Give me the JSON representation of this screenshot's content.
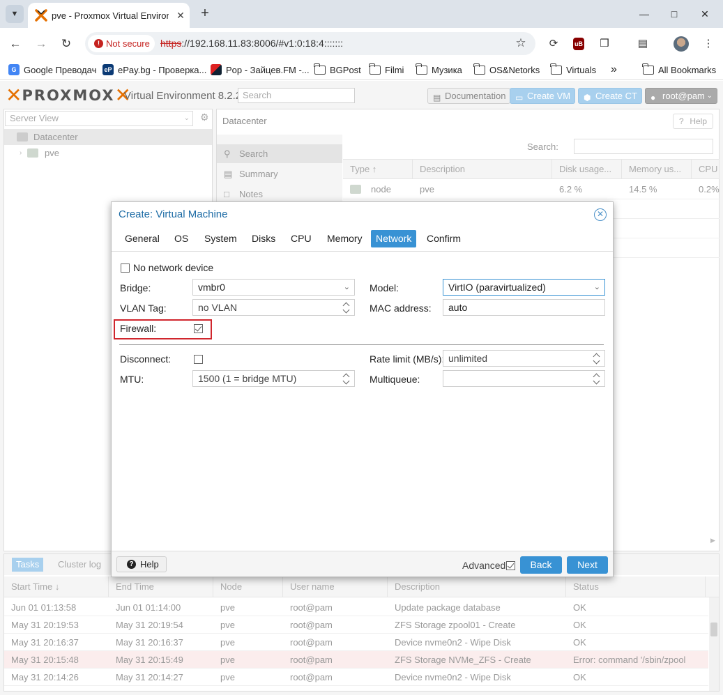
{
  "browser": {
    "tab_title": "pve - Proxmox Virtual Environme",
    "url_scheme": "https",
    "url_rest": "://192.168.11.83:8006/#v1:0:18:4:::::::",
    "not_secure": "Not secure",
    "bookmarks": [
      {
        "label": "Google Преводач",
        "icon": "translate-icon"
      },
      {
        "label": "ePay.bg - Проверка...",
        "icon": "epay-icon"
      },
      {
        "label": "Pop - Зайцев.FM -...",
        "icon": "zaycev-icon"
      },
      {
        "label": "BGPost",
        "icon": "folder-icon"
      },
      {
        "label": "Filmi",
        "icon": "folder-icon"
      },
      {
        "label": "Музика",
        "icon": "folder-icon"
      },
      {
        "label": "OS&Netorks",
        "icon": "folder-icon"
      },
      {
        "label": "Virtuals",
        "icon": "folder-icon"
      }
    ],
    "bookmarks_more": "»",
    "all_bookmarks": "All Bookmarks"
  },
  "pve": {
    "logo": "PROXMOX",
    "version": "Virtual Environment 8.2.2",
    "search_placeholder": "Search",
    "documentation": "Documentation",
    "create_vm": "Create VM",
    "create_ct": "Create CT",
    "user": "root@pam",
    "accent": "#e57000"
  },
  "tree": {
    "view": "Server View",
    "items": [
      "Datacenter",
      "pve"
    ]
  },
  "datacenter": {
    "title": "Datacenter",
    "help": "Help",
    "nav": [
      "Search",
      "Summary",
      "Notes"
    ],
    "search_label": "Search:",
    "columns": [
      "Type ↑",
      "Description",
      "Disk usage...",
      "Memory us...",
      "CPU"
    ],
    "rows": [
      {
        "type": "node",
        "description": "pve",
        "disk": "6.2 %",
        "memory": "14.5 %",
        "cpu": "0.2%"
      }
    ]
  },
  "tasks": {
    "tabs": [
      "Tasks",
      "Cluster log"
    ],
    "columns": [
      "Start Time ↓",
      "End Time",
      "Node",
      "User name",
      "Description",
      "Status"
    ],
    "rows": [
      {
        "start": "Jun 01 01:13:58",
        "end": "Jun 01 01:14:00",
        "node": "pve",
        "user": "root@pam",
        "desc": "Update package database",
        "status": "OK"
      },
      {
        "start": "May 31 20:19:53",
        "end": "May 31 20:19:54",
        "node": "pve",
        "user": "root@pam",
        "desc": "ZFS Storage zpool01 - Create",
        "status": "OK"
      },
      {
        "start": "May 31 20:16:37",
        "end": "May 31 20:16:37",
        "node": "pve",
        "user": "root@pam",
        "desc": "Device nvme0n2 - Wipe Disk",
        "status": "OK"
      },
      {
        "start": "May 31 20:15:48",
        "end": "May 31 20:15:49",
        "node": "pve",
        "user": "root@pam",
        "desc": "ZFS Storage NVMe_ZFS - Create",
        "status": "Error: command '/sbin/zpool"
      },
      {
        "start": "May 31 20:14:26",
        "end": "May 31 20:14:27",
        "node": "pve",
        "user": "root@pam",
        "desc": "Device nvme0n2 - Wipe Disk",
        "status": "OK"
      }
    ]
  },
  "modal": {
    "title": "Create: Virtual Machine",
    "tabs": [
      "General",
      "OS",
      "System",
      "Disks",
      "CPU",
      "Memory",
      "Network",
      "Confirm"
    ],
    "active_tab": "Network",
    "no_network_device": "No network device",
    "bridge_label": "Bridge:",
    "bridge_value": "vmbr0",
    "vlan_label": "VLAN Tag:",
    "vlan_value": "no VLAN",
    "firewall_label": "Firewall:",
    "model_label": "Model:",
    "model_value": "VirtIO (paravirtualized)",
    "mac_label": "MAC address:",
    "mac_value": "auto",
    "disconnect_label": "Disconnect:",
    "mtu_label": "MTU:",
    "mtu_value": "1500 (1 = bridge MTU)",
    "rate_label": "Rate limit (MB/s):",
    "rate_value": "unlimited",
    "multiqueue_label": "Multiqueue:",
    "multiqueue_value": "",
    "help": "Help",
    "advanced": "Advanced",
    "back": "Back",
    "next": "Next",
    "highlight_color": "#d0262d",
    "accent": "#3892d4"
  }
}
